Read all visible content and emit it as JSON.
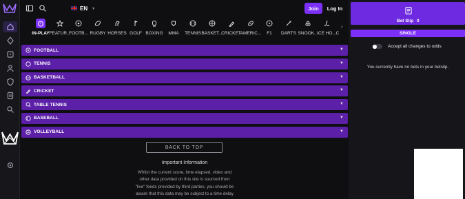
{
  "header": {
    "language": "EN",
    "join_label": "Join",
    "login_label": "Log In"
  },
  "sports_nav": [
    {
      "label": "IN-PLAY",
      "icon": "stopwatch-icon",
      "active": true
    },
    {
      "label": "FEATUR...",
      "icon": "star-icon"
    },
    {
      "label": "FOOTB...",
      "icon": "football-icon"
    },
    {
      "label": "RUGBY",
      "icon": "rugby-ball-icon"
    },
    {
      "label": "HORSES",
      "icon": "horse-icon"
    },
    {
      "label": "GOLF",
      "icon": "golf-flag-icon"
    },
    {
      "label": "BOXING",
      "icon": "boxing-glove-icon"
    },
    {
      "label": "MMA",
      "icon": "mma-glove-icon"
    },
    {
      "label": "TENNIS",
      "icon": "tennis-ball-icon"
    },
    {
      "label": "BASKET...",
      "icon": "basketball-icon"
    },
    {
      "label": "CRICKET",
      "icon": "cricket-bat-icon"
    },
    {
      "label": "AMERIC...",
      "icon": "american-football-icon"
    },
    {
      "label": "F1",
      "icon": "steering-wheel-icon"
    },
    {
      "label": "DARTS",
      "icon": "dart-icon"
    },
    {
      "label": "SNOOK...",
      "icon": "snooker-icon"
    },
    {
      "label": "ICE HO...",
      "icon": "ice-hockey-icon"
    },
    {
      "label": "C",
      "icon": "sport-icon"
    }
  ],
  "competitions": [
    {
      "label": "FOOTBALL",
      "icon": "football-icon"
    },
    {
      "label": "TENNIS",
      "icon": "tennis-ball-icon"
    },
    {
      "label": "BASKETBALL",
      "icon": "basketball-icon"
    },
    {
      "label": "CRICKET",
      "icon": "cricket-bat-icon"
    },
    {
      "label": "TABLE TENNIS",
      "icon": "table-tennis-icon"
    },
    {
      "label": "BASEBALL",
      "icon": "baseball-icon"
    },
    {
      "label": "VOLLEYBALL",
      "icon": "volleyball-icon"
    }
  ],
  "back_to_top_label": "BACK TO TOP",
  "important": {
    "title": "Important Information",
    "body": "Whilst the current score, time elapsed, video and other data provided on this site is sourced from \"live\" feeds provided by third parties, you should be aware that this data may be subject to a time delay and/or be inaccurate. Please also"
  },
  "betslip": {
    "title": "Bet Slip",
    "count": "0",
    "tab_single": "SINGLE",
    "accept_odds_label": "Accept all changes to odds",
    "accept_odds_on": false,
    "empty_message": "You currently have no bets in your betslip."
  },
  "colors": {
    "accent": "#7b2ff7",
    "row_purple": "#5b1fa8",
    "background": "#0f0f12"
  }
}
